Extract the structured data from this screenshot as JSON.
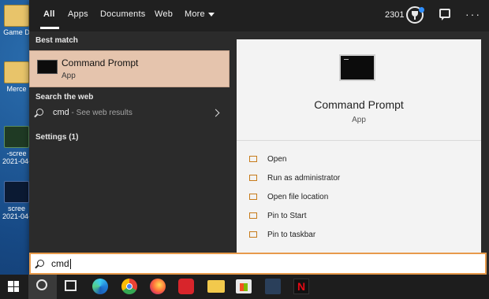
{
  "desktop": {
    "icons": [
      {
        "label": "Game D"
      },
      {
        "label": "Merce"
      },
      {
        "label": "-scree\n2021-04-"
      },
      {
        "label": "scree\n2021-04-"
      }
    ]
  },
  "topbar": {
    "tabs": [
      {
        "label": "All",
        "active": true
      },
      {
        "label": "Apps"
      },
      {
        "label": "Documents"
      },
      {
        "label": "Web"
      },
      {
        "label": "More"
      }
    ],
    "points": "2301",
    "icons": [
      "trophy-icon",
      "feedback-icon",
      "ellipsis-icon"
    ]
  },
  "left": {
    "best_match_header": "Best match",
    "best_match": {
      "title": "Command Prompt",
      "subtitle": "App"
    },
    "search_web_header": "Search the web",
    "web_result": {
      "query": "cmd",
      "hint": " - See web results"
    },
    "settings_header": "Settings (1)"
  },
  "right": {
    "title": "Command Prompt",
    "subtitle": "App",
    "actions": [
      {
        "label": "Open"
      },
      {
        "label": "Run as administrator"
      },
      {
        "label": "Open file location"
      },
      {
        "label": "Pin to Start"
      },
      {
        "label": "Pin to taskbar"
      }
    ]
  },
  "search": {
    "value": "cmd"
  },
  "taskbar": {
    "items": [
      "windows-start-icon",
      "cortana-icon",
      "task-view-icon",
      "edge-icon",
      "chrome-icon",
      "firefox-icon",
      "vpn-app-icon",
      "file-explorer-icon",
      "store-icon",
      "steam-app-icon",
      "netflix-icon"
    ],
    "netflix_label": "N"
  },
  "colors": {
    "accent": "#e79a4b",
    "selection": "#e5c4ad",
    "panel": "#2b2b2b"
  }
}
